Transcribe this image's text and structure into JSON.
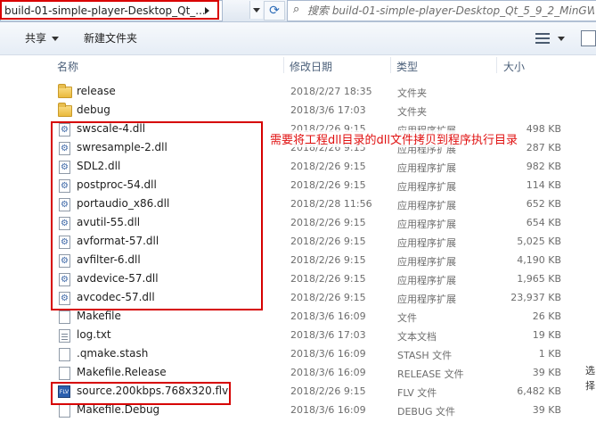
{
  "address": {
    "path": "build-01-simple-player-Desktop_Qt_..."
  },
  "search": {
    "placeholder": "搜索 build-01-simple-player-Desktop_Qt_5_9_2_MinGW_3..."
  },
  "toolbar": {
    "share_label": "共享",
    "new_folder_label": "新建文件夹"
  },
  "columns": {
    "name": "名称",
    "modified": "修改日期",
    "type": "类型",
    "size": "大小"
  },
  "files": [
    {
      "name": "release",
      "date": "2018/2/27 18:35",
      "type": "文件夹",
      "size": "",
      "icon": "folder-icon"
    },
    {
      "name": "debug",
      "date": "2018/3/6 17:03",
      "type": "文件夹",
      "size": "",
      "icon": "folder-icon"
    },
    {
      "name": "swscale-4.dll",
      "date": "2018/2/26 9:15",
      "type": "应用程序扩展",
      "size": "498 KB",
      "icon": "dll-icon"
    },
    {
      "name": "swresample-2.dll",
      "date": "2018/2/26 9:15",
      "type": "应用程序扩展",
      "size": "287 KB",
      "icon": "dll-icon"
    },
    {
      "name": "SDL2.dll",
      "date": "2018/2/26 9:15",
      "type": "应用程序扩展",
      "size": "982 KB",
      "icon": "dll-icon"
    },
    {
      "name": "postproc-54.dll",
      "date": "2018/2/26 9:15",
      "type": "应用程序扩展",
      "size": "114 KB",
      "icon": "dll-icon"
    },
    {
      "name": "portaudio_x86.dll",
      "date": "2018/2/28 11:56",
      "type": "应用程序扩展",
      "size": "652 KB",
      "icon": "dll-icon"
    },
    {
      "name": "avutil-55.dll",
      "date": "2018/2/26 9:15",
      "type": "应用程序扩展",
      "size": "654 KB",
      "icon": "dll-icon"
    },
    {
      "name": "avformat-57.dll",
      "date": "2018/2/26 9:15",
      "type": "应用程序扩展",
      "size": "5,025 KB",
      "icon": "dll-icon"
    },
    {
      "name": "avfilter-6.dll",
      "date": "2018/2/26 9:15",
      "type": "应用程序扩展",
      "size": "4,190 KB",
      "icon": "dll-icon"
    },
    {
      "name": "avdevice-57.dll",
      "date": "2018/2/26 9:15",
      "type": "应用程序扩展",
      "size": "1,965 KB",
      "icon": "dll-icon"
    },
    {
      "name": "avcodec-57.dll",
      "date": "2018/2/26 9:15",
      "type": "应用程序扩展",
      "size": "23,937 KB",
      "icon": "dll-icon"
    },
    {
      "name": "Makefile",
      "date": "2018/3/6 16:09",
      "type": "文件",
      "size": "26 KB",
      "icon": "file-icon"
    },
    {
      "name": "log.txt",
      "date": "2018/3/6 17:03",
      "type": "文本文档",
      "size": "19 KB",
      "icon": "text-file-icon"
    },
    {
      "name": ".qmake.stash",
      "date": "2018/3/6 16:09",
      "type": "STASH 文件",
      "size": "1 KB",
      "icon": "file-icon"
    },
    {
      "name": "Makefile.Release",
      "date": "2018/3/6 16:09",
      "type": "RELEASE 文件",
      "size": "39 KB",
      "icon": "file-icon"
    },
    {
      "name": "source.200kbps.768x320.flv",
      "date": "2018/2/26 9:15",
      "type": "FLV 文件",
      "size": "6,482 KB",
      "icon": "flv-file-icon"
    },
    {
      "name": "Makefile.Debug",
      "date": "2018/3/6 16:09",
      "type": "DEBUG 文件",
      "size": "39 KB",
      "icon": "file-icon"
    }
  ],
  "annotation": {
    "note": "需要将工程dll目录的dll文件拷贝到程序执行目录"
  },
  "edge_chars": [
    "选",
    "择"
  ],
  "flv_icon_text": "FLV",
  "colors": {
    "highlight": "#d60000",
    "annotation_text": "#e01010"
  }
}
